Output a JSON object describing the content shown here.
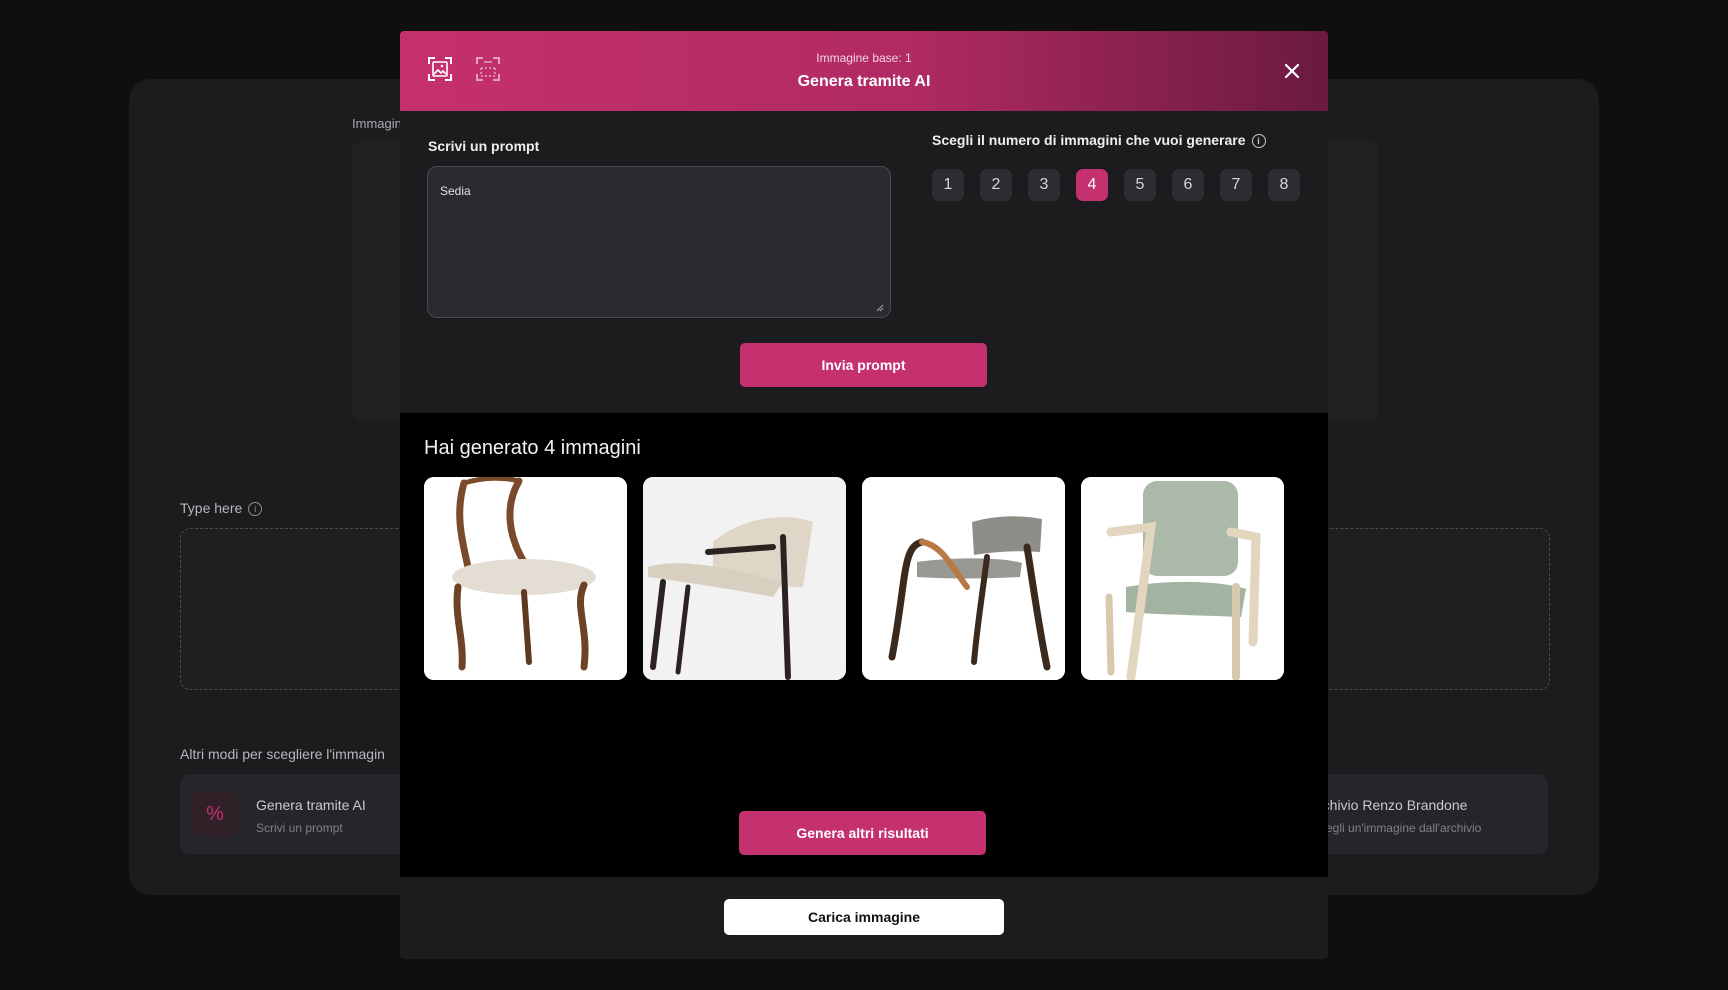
{
  "background": {
    "upload_label": "Immagin",
    "type_here_label": "Type here",
    "other_ways_label": "Altri modi per scegliere l'immagin",
    "option_ai": {
      "title": "Genera tramite AI",
      "subtitle": "Scrivi un prompt",
      "icon": "percent-icon"
    },
    "option_archive": {
      "title": "rchivio Renzo Brandone",
      "subtitle": "egli un'immagine dall'archivio"
    }
  },
  "modal": {
    "header": {
      "subtitle": "Immagine base: 1",
      "title": "Genera tramite AI",
      "icons": [
        "image-frame-icon",
        "image-frame-dashed-icon",
        "close-icon"
      ],
      "gradient": [
        "#c5306e",
        "#6a1a40"
      ]
    },
    "prompt": {
      "label": "Scrivi un prompt",
      "value": "Sedia"
    },
    "count": {
      "label": "Scegli il numero di immagini che vuoi generare",
      "options": [
        "1",
        "2",
        "3",
        "4",
        "5",
        "6",
        "7",
        "8"
      ],
      "selected": "4"
    },
    "send_button": "Invia prompt",
    "results": {
      "title": "Hai generato 4 immagini",
      "images": [
        "wooden-chair-beige-seat",
        "dark-lounge-chair",
        "curved-armchair-grey",
        "light-armchair-sage"
      ]
    },
    "more_button": "Genera altri  risultati",
    "upload_button": "Carica immagine"
  },
  "colors": {
    "accent": "#c5306e",
    "background": "#0f0f10",
    "card": "#1c1c1e"
  }
}
